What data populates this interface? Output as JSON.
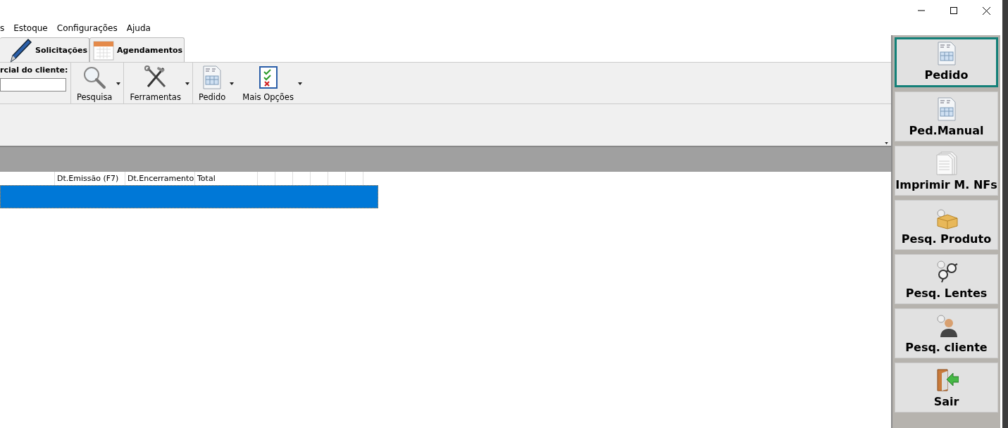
{
  "menu": [
    "s",
    "Estoque",
    "Configurações",
    "Ajuda"
  ],
  "tabs": [
    {
      "label": "Solicitações",
      "selected": false
    },
    {
      "label": "Agendamentos",
      "selected": false
    }
  ],
  "toolbar": {
    "search_label": "rcial do cliente:",
    "tools": [
      "Pesquisa",
      "Ferramentas",
      "Pedido",
      "Mais Opções"
    ]
  },
  "table": {
    "columns": [
      "Dt.Emissão (F7)",
      "Dt.Encerramento",
      "Total"
    ],
    "rows": [
      {
        "selected": true
      }
    ]
  },
  "sidebar": [
    {
      "label": "Pedido",
      "selected": true
    },
    {
      "label": "Ped.Manual",
      "selected": false
    },
    {
      "label": "Imprimir M. NFs",
      "selected": false
    },
    {
      "label": "Pesq. Produto",
      "selected": false
    },
    {
      "label": "Pesq. Lentes",
      "selected": false
    },
    {
      "label": "Pesq. cliente",
      "selected": false
    },
    {
      "label": "Sair",
      "selected": false
    }
  ]
}
